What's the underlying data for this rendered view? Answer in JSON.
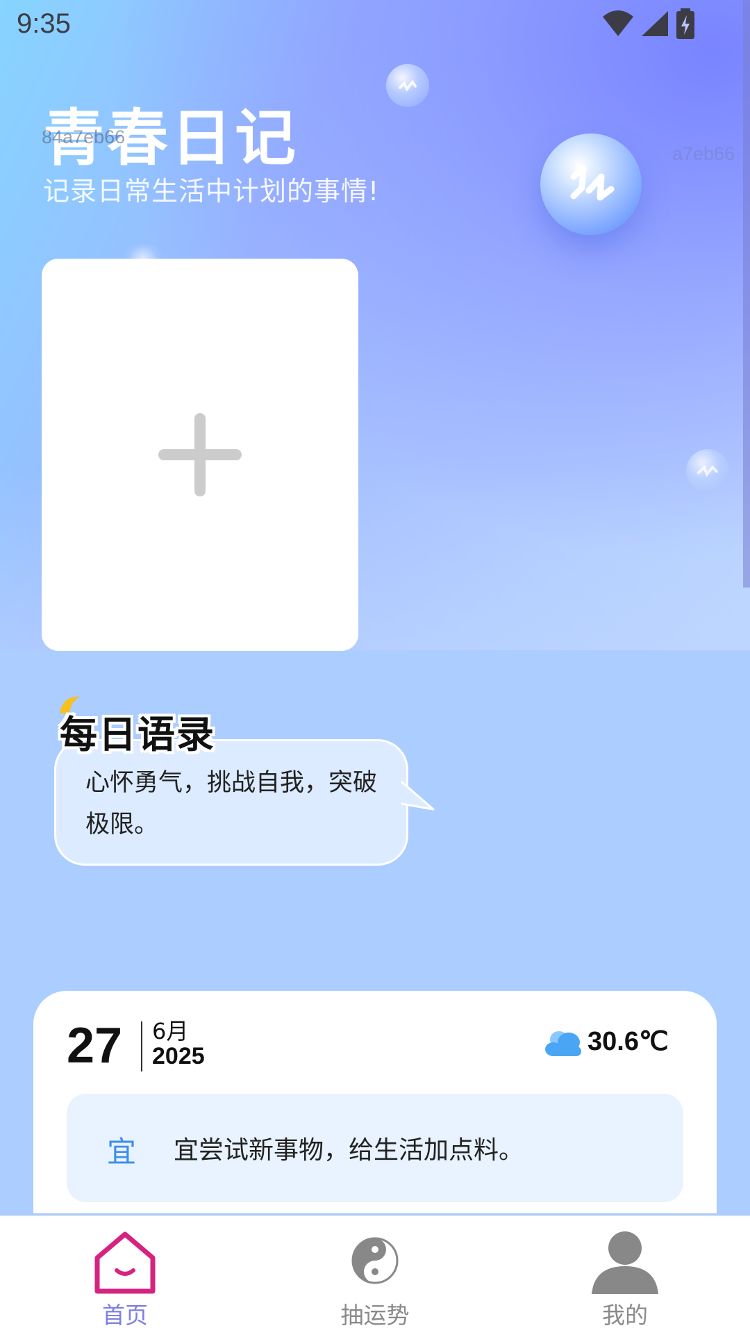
{
  "status_bar": {
    "time": "9:35",
    "icons": [
      "wifi-icon",
      "signal-icon",
      "battery-charging-icon"
    ]
  },
  "header": {
    "title": "青春日记",
    "subtitle": "记录日常生活中计划的事情!",
    "watermark_left": "84a7eb66",
    "watermark_right": "a7eb66"
  },
  "add_card": {
    "icon": "plus-icon"
  },
  "daily_quote": {
    "title": "每日语录",
    "text": "心怀勇气，挑战自我，突破极限。"
  },
  "calendar": {
    "day": "27",
    "month": "6月",
    "year": "2025",
    "weather_icon": "cloud-icon",
    "temperature": "30.6℃",
    "yi_label": "宜",
    "yi_text": "宜尝试新事物，给生活加点料。"
  },
  "bottom_nav": {
    "items": [
      {
        "label": "首页",
        "icon": "home-icon",
        "active": true
      },
      {
        "label": "抽运势",
        "icon": "yin-yang-icon",
        "active": false
      },
      {
        "label": "我的",
        "icon": "person-icon",
        "active": false
      }
    ]
  },
  "colors": {
    "background": "#abcdff",
    "active_nav": "#7f7fe0",
    "home_icon": "#d6237f",
    "yi_label": "#3c8cf0",
    "inactive_nav": "#8a8a8a"
  }
}
